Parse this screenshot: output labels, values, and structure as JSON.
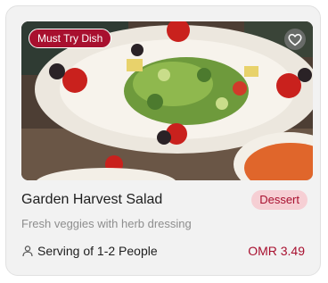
{
  "card": {
    "badge": "Must Try Dish",
    "title": "Garden Harvest Salad",
    "category": "Dessert",
    "description": "Fresh veggies with herb dressing",
    "serving": "Serving of 1-2 People",
    "price": "OMR 3.49",
    "favorite_icon": "heart-icon",
    "serving_icon": "person-icon"
  },
  "colors": {
    "accent": "#a8102f",
    "category_bg": "#f6cfd4",
    "card_bg": "#f2f2f2"
  }
}
